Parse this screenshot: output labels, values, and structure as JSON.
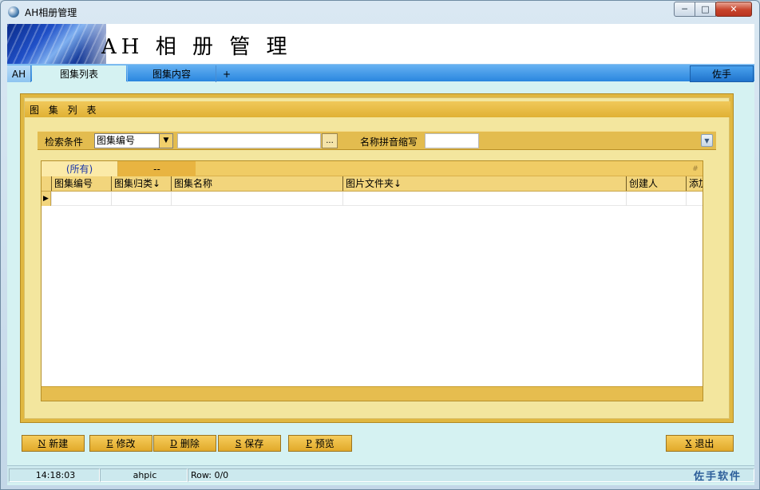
{
  "window": {
    "title": "AH相册管理",
    "controls": {
      "minimize": "─",
      "maximize": "□",
      "close": "✕"
    }
  },
  "banner": {
    "title": "AH 相 册 管 理"
  },
  "tabs": {
    "prefix": "AH",
    "items": [
      {
        "label": "图集列表",
        "active": true
      },
      {
        "label": "图集内容",
        "active": false
      }
    ],
    "add": "+",
    "user": "佐手"
  },
  "panel": {
    "title": "图 集 列 表",
    "search": {
      "condition_label": "检索条件",
      "field_selected": "图集编号",
      "search_value": "",
      "browse_label": "...",
      "pinyin_label": "名称拼音缩写",
      "pinyin_value": ""
    },
    "grid": {
      "filter_tabs": [
        "(所有)",
        "--"
      ],
      "hash": "#",
      "columns": [
        "图集编号",
        "图集归类↓",
        "图集名称",
        "图片文件夹↓",
        "创建人",
        "添加"
      ],
      "rows": [
        {
          "cells": [
            "",
            "",
            "",
            "",
            "",
            ""
          ],
          "current": true
        }
      ]
    }
  },
  "actions": {
    "new": {
      "key": "N",
      "label": "新建"
    },
    "edit": {
      "key": "E",
      "label": "修改"
    },
    "delete": {
      "key": "D",
      "label": "删除"
    },
    "save": {
      "key": "S",
      "label": "保存"
    },
    "preview": {
      "key": "P",
      "label": "预览"
    },
    "exit": {
      "key": "X",
      "label": "退出"
    }
  },
  "status": {
    "time": "14:18:03",
    "user": "ahpic",
    "row": "Row: 0/0",
    "brand": "佐手软件"
  },
  "colors": {
    "client_bg": "#d5f2f2",
    "tab_blue": "#2a86df",
    "panel_gold": "#e0b740",
    "panel_light": "#f3e69e",
    "button_gold": "#e1a92a",
    "brand_blue": "#2c5e9a"
  }
}
